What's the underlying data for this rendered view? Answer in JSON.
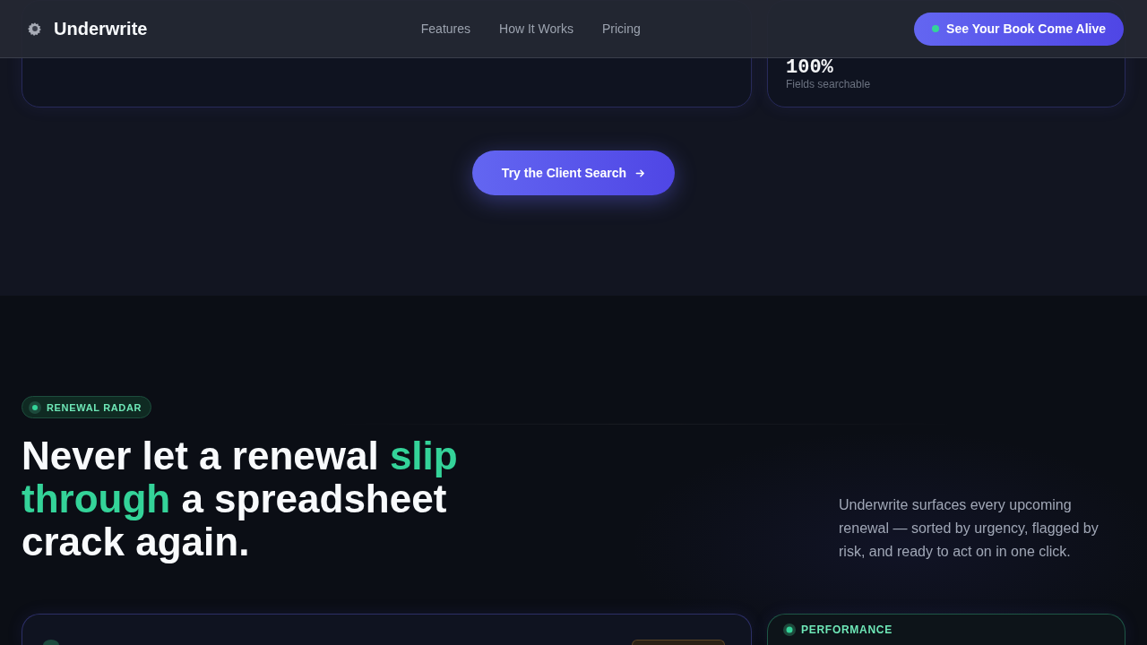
{
  "header": {
    "brand": "Underwrite",
    "nav": [
      "Features",
      "How It Works",
      "Pricing"
    ],
    "cta": "See Your Book Come Alive"
  },
  "stats_section": {
    "stat": {
      "value": "100%",
      "label": "Fields searchable"
    },
    "button": "Try the Client Search"
  },
  "renewal_section": {
    "badge": "RENEWAL RADAR",
    "headline": [
      {
        "text": "Never let a renewal ",
        "accent": false
      },
      {
        "text": "slip through",
        "accent": true
      },
      {
        "text": " a spreadsheet crack again.",
        "accent": false
      }
    ],
    "description": "Underwrite surfaces every upcoming renewal — sorted by urgency, flagged by risk, and ready to act on in one click."
  },
  "cards": [
    {
      "kind": "preview"
    },
    {
      "kind": "labelled",
      "label": "PERFORMANCE"
    }
  ]
}
